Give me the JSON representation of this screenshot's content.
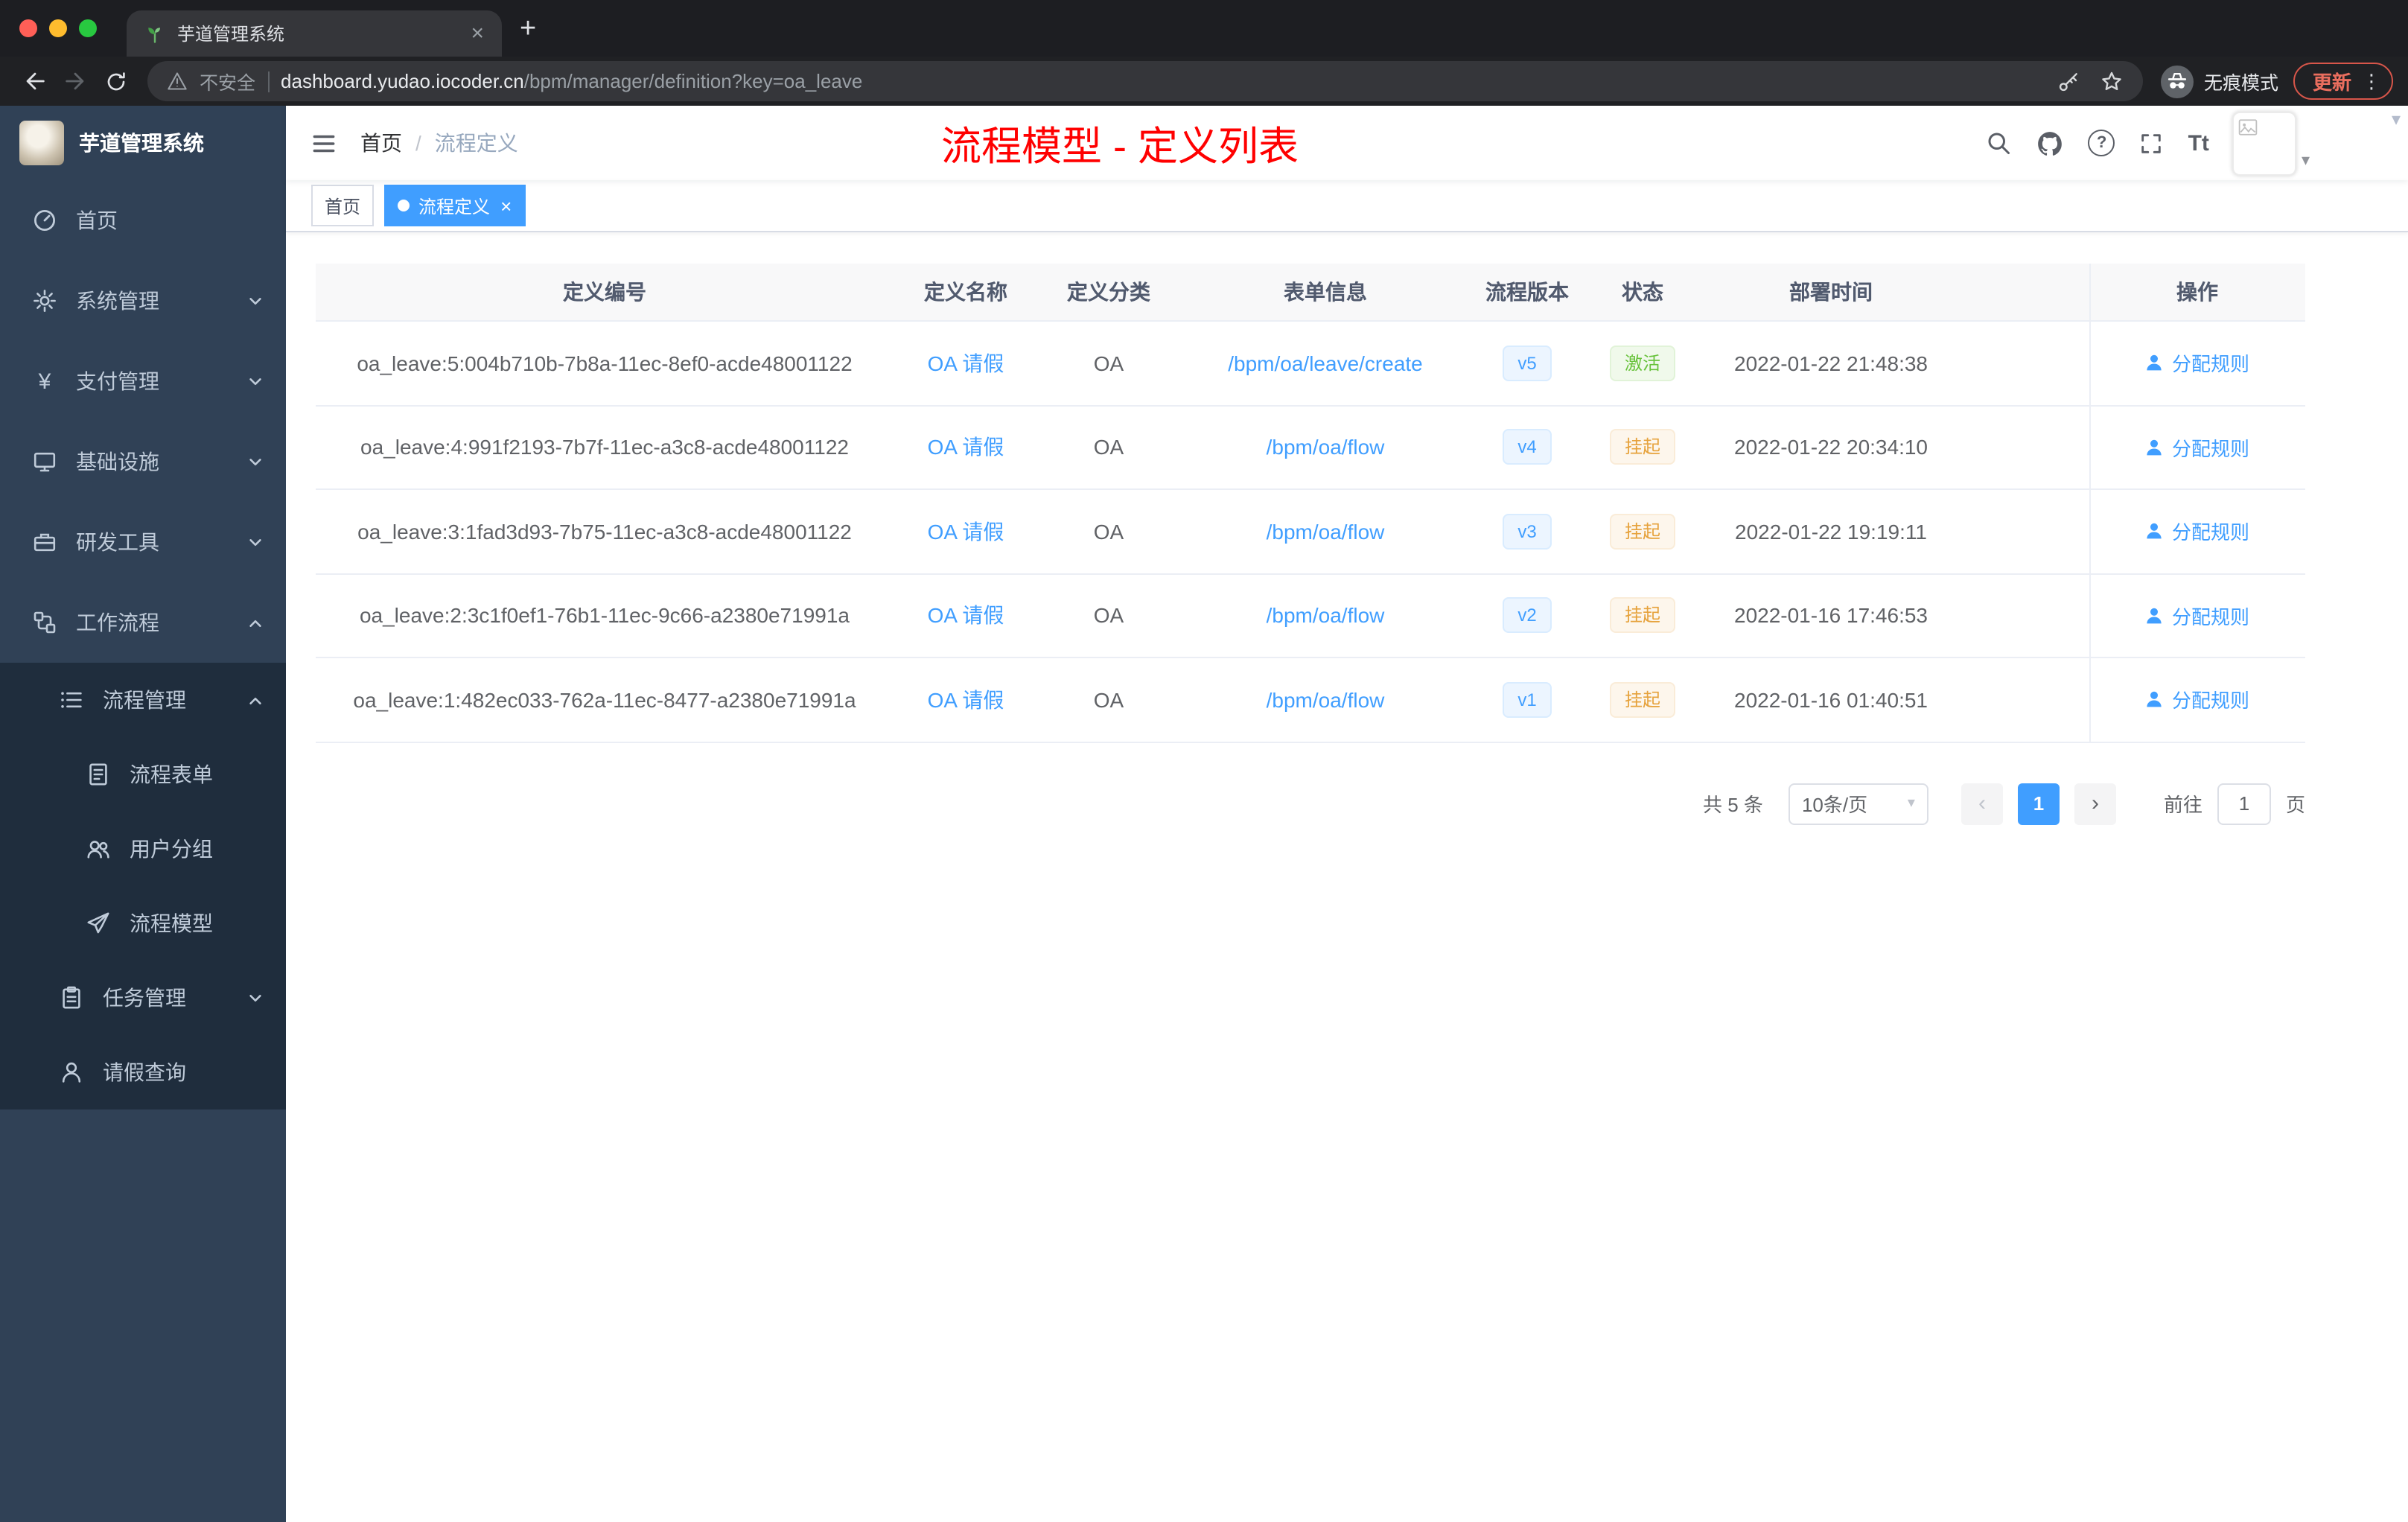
{
  "colors": {
    "accent": "#409eff",
    "success": "#67c23a",
    "warning": "#e6a23c",
    "annotation_red": "#ff0000",
    "sidebar_bg": "#304156"
  },
  "browser": {
    "tab_title": "芋道管理系统",
    "security_label": "不安全",
    "url_domain": "dashboard.yudao.iocoder.cn",
    "url_path": "/bpm/manager/definition?key=oa_leave",
    "incognito_label": "无痕模式",
    "update_label": "更新"
  },
  "icons": {
    "tab_close": "×",
    "new_tab": "+",
    "menu_dots": "⋮",
    "question": "?",
    "text_size": "Tt",
    "yen": "¥",
    "caret_down": "▾",
    "select_caret": "▾",
    "page_prev": "‹",
    "page_next": "›",
    "tag_close": "×"
  },
  "sidebar": {
    "logo_title": "芋道管理系统",
    "items": [
      "首页",
      "系统管理",
      "支付管理",
      "基础设施",
      "研发工具",
      "工作流程"
    ],
    "sub_items": [
      "流程管理",
      "流程表单",
      "用户分组",
      "流程模型",
      "任务管理",
      "请假查询"
    ]
  },
  "header": {
    "breadcrumb_home": "首页",
    "breadcrumb_sep": "/",
    "breadcrumb_current": "流程定义",
    "annotation": "流程模型 - 定义列表"
  },
  "tags": {
    "home": "首页",
    "active": "流程定义"
  },
  "table": {
    "columns": {
      "id": "定义编号",
      "name": "定义名称",
      "category": "定义分类",
      "form": "表单信息",
      "version": "流程版本",
      "status": "状态",
      "deploy_time": "部署时间",
      "actions": "操作"
    },
    "action_label": "分配规则",
    "rows": [
      {
        "id": "oa_leave:5:004b710b-7b8a-11ec-8ef0-acde48001122",
        "name": "OA 请假",
        "category": "OA",
        "form": "/bpm/oa/leave/create",
        "version": "v5",
        "status": "激活",
        "status_type": "success",
        "deploy_time": "2022-01-22 21:48:38"
      },
      {
        "id": "oa_leave:4:991f2193-7b7f-11ec-a3c8-acde48001122",
        "name": "OA 请假",
        "category": "OA",
        "form": "/bpm/oa/flow",
        "version": "v4",
        "status": "挂起",
        "status_type": "warning",
        "deploy_time": "2022-01-22 20:34:10"
      },
      {
        "id": "oa_leave:3:1fad3d93-7b75-11ec-a3c8-acde48001122",
        "name": "OA 请假",
        "category": "OA",
        "form": "/bpm/oa/flow",
        "version": "v3",
        "status": "挂起",
        "status_type": "warning",
        "deploy_time": "2022-01-22 19:19:11"
      },
      {
        "id": "oa_leave:2:3c1f0ef1-76b1-11ec-9c66-a2380e71991a",
        "name": "OA 请假",
        "category": "OA",
        "form": "/bpm/oa/flow",
        "version": "v2",
        "status": "挂起",
        "status_type": "warning",
        "deploy_time": "2022-01-16 17:46:53"
      },
      {
        "id": "oa_leave:1:482ec033-762a-11ec-8477-a2380e71991a",
        "name": "OA 请假",
        "category": "OA",
        "form": "/bpm/oa/flow",
        "version": "v1",
        "status": "挂起",
        "status_type": "warning",
        "deploy_time": "2022-01-16 01:40:51"
      }
    ]
  },
  "pagination": {
    "total": "共 5 条",
    "page_size": "10条/页",
    "page": "1",
    "goto_label": "前往",
    "goto_value": "1",
    "unit": "页"
  }
}
